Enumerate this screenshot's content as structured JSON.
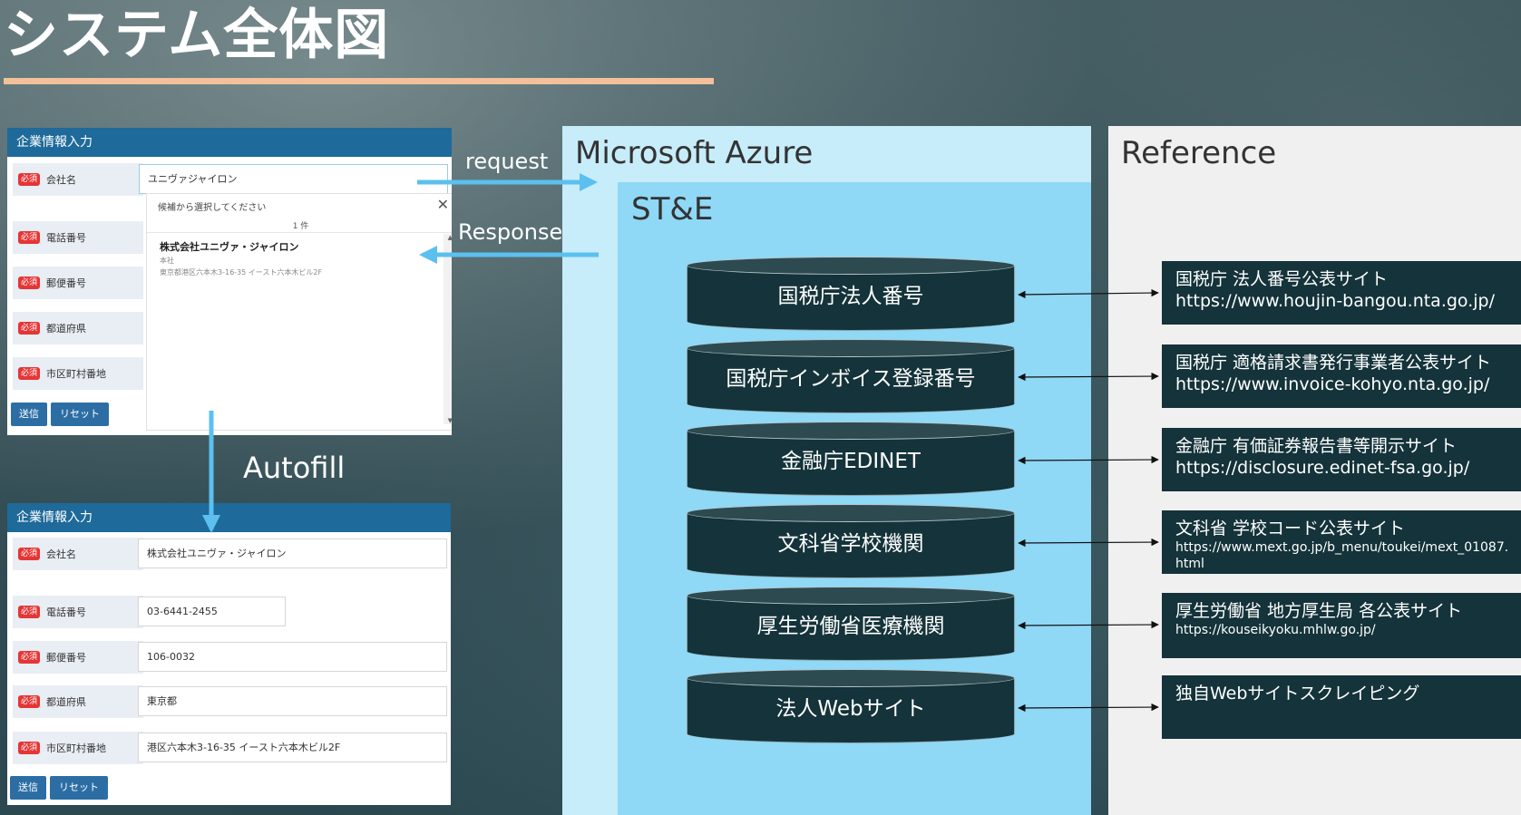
{
  "slide": {
    "title": "システム全体図"
  },
  "form_top": {
    "header": "企業情報入力",
    "required_badge": "必須",
    "fields": [
      {
        "label": "会社名",
        "value": "ユニヴァジャイロン"
      },
      {
        "label": "電話番号",
        "value": ""
      },
      {
        "label": "郵便番号",
        "value": ""
      },
      {
        "label": "都道府県",
        "value": ""
      },
      {
        "label": "市区町村番地",
        "value": ""
      }
    ],
    "dropdown": {
      "hint": "候補から選択してください",
      "count": "1 件",
      "candidate_name": "株式会社ユニヴァ・ジャイロン",
      "candidate_branch": "本社",
      "candidate_address": "東京都港区六本木3-16-35 イースト六本木ビル2F"
    },
    "submit_label": "送信",
    "reset_label": "リセット"
  },
  "form_bottom": {
    "header": "企業情報入力",
    "required_badge": "必須",
    "fields": [
      {
        "label": "会社名",
        "value": "株式会社ユニヴァ・ジャイロン"
      },
      {
        "label": "電話番号",
        "value": "03-6441-2455"
      },
      {
        "label": "郵便番号",
        "value": "106-0032"
      },
      {
        "label": "都道府県",
        "value": "東京都"
      },
      {
        "label": "市区町村番地",
        "value": "港区六本木3-16-35 イースト六本木ビル2F"
      }
    ],
    "submit_label": "送信",
    "reset_label": "リセット"
  },
  "flows": {
    "request": "request",
    "response": "Response",
    "autofill": "Autofill"
  },
  "azure": {
    "title": "Microsoft Azure",
    "ste_title": "ST&E",
    "databases": [
      "国税庁法人番号",
      "国税庁インボイス登録番号",
      "金融庁EDINET",
      "文科省学校機関",
      "厚生労働省医療機関",
      "法人Webサイト"
    ]
  },
  "reference": {
    "title": "Reference",
    "items": [
      {
        "name": "国税庁 法人番号公表サイト",
        "url": "https://www.houjin-bangou.nta.go.jp/"
      },
      {
        "name": "国税庁 適格請求書発行事業者公表サイト",
        "url": "https://www.invoice-kohyo.nta.go.jp/"
      },
      {
        "name": "金融庁 有価証券報告書等開示サイト",
        "url": "https://disclosure.edinet-fsa.go.jp/"
      },
      {
        "name": "文科省 学校コード公表サイト",
        "url": "https://www.mext.go.jp/b_menu/toukei/mext_01087.html"
      },
      {
        "name": "厚生労働省 地方厚生局 各公表サイト",
        "url": "https://kouseikyoku.mhlw.go.jp/"
      },
      {
        "name": "独自Webサイトスクレイピング",
        "url": ""
      }
    ]
  },
  "colors": {
    "azure_panel": "#c7ecfa",
    "ste_panel": "#8fd8f6",
    "reference_panel": "#f0f0f0",
    "db_fill": "#14333a",
    "form_header": "#1e6a9a",
    "arrow": "#5bc0ef",
    "title_rule": "#f2c09a"
  }
}
